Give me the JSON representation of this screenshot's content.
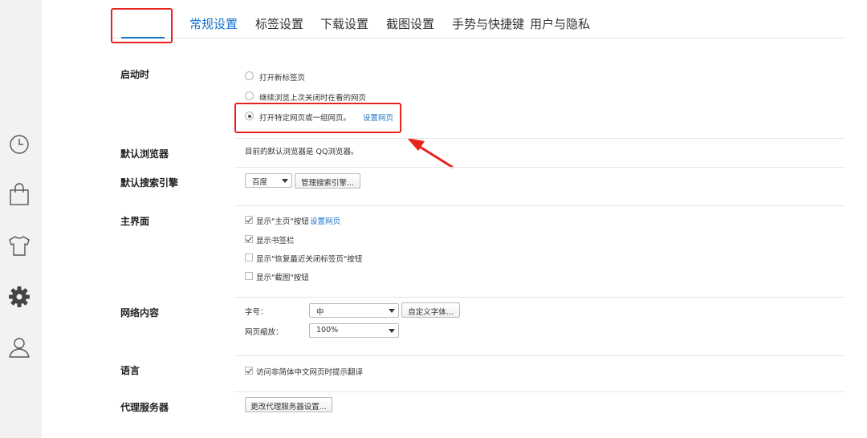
{
  "tabs": [
    {
      "label": "常规设置",
      "active": true
    },
    {
      "label": "标签设置"
    },
    {
      "label": "下载设置"
    },
    {
      "label": "截图设置"
    },
    {
      "label": "手势与快捷键"
    },
    {
      "label": "用户与隐私"
    }
  ],
  "sidebar": {
    "icons": [
      "clock-icon",
      "shopping-bag-icon",
      "shirt-icon",
      "gear-icon",
      "user-icon"
    ]
  },
  "startup": {
    "label": "启动时",
    "options": [
      "打开新标签页",
      "继续浏览上次关闭时在看的网页",
      "打开特定网页或一组网页。"
    ],
    "selected_index": 2,
    "set_pages_link": "设置网页"
  },
  "default_browser": {
    "label": "默认浏览器",
    "text": "目前的默认浏览器是 QQ浏览器。"
  },
  "search_engine": {
    "label": "默认搜索引擎",
    "value": "百度",
    "manage_button": "管理搜索引擎..."
  },
  "main_ui": {
    "label": "主界面",
    "checkboxes": [
      {
        "text": "显示\"主页\"按钮",
        "checked": true
      },
      {
        "text": "显示书签栏",
        "checked": true
      },
      {
        "text": "显示\"恢复最近关闭标签页\"按钮",
        "checked": false
      },
      {
        "text": "显示\"截图\"按钮",
        "checked": false
      }
    ],
    "home_link": "设置网页"
  },
  "web_content": {
    "label": "网络内容",
    "font_size_label": "字号：",
    "font_size_value": "中",
    "custom_font_button": "自定义字体...",
    "zoom_label": "网页缩放：",
    "zoom_value": "100%"
  },
  "language": {
    "label": "语言",
    "checkbox_text": "访问非简体中文网页时提示翻译",
    "checked": true
  },
  "proxy": {
    "label": "代理服务器",
    "button": "更改代理服务器设置..."
  },
  "colors": {
    "accent": "#1a73c8",
    "highlight": "#e8231d"
  }
}
